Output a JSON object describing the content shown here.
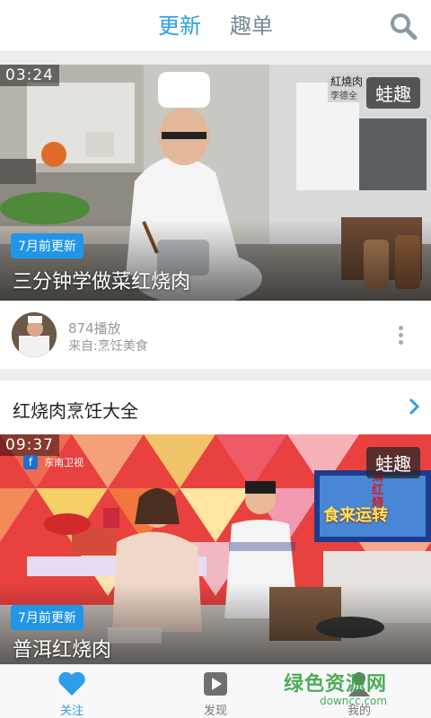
{
  "tabs": {
    "updates": "更新",
    "fun_lists": "趣单"
  },
  "colors": {
    "accent": "#2f9ee8",
    "badge": "#2196e8"
  },
  "icons": {
    "search": "search-icon",
    "more": "more-vertical-icon",
    "chevron": "chevron-right-icon",
    "follow": "heart-icon",
    "discover": "play-icon",
    "mine": "user-icon"
  },
  "video1": {
    "duration": "03:24",
    "brand": "蛙趣",
    "badge": "7月前更新",
    "title": "三分钟学做菜红烧肉",
    "overlay_caption": "紅燒肉",
    "overlay_sub": "李德全",
    "plays": "874播放",
    "source": "来自:烹饪美食"
  },
  "section": {
    "title": "红烧肉烹饪大全"
  },
  "video2": {
    "duration": "09:37",
    "channel": "东南卫视",
    "brand": "蛙趣",
    "badge": "7月前更新",
    "title": "普洱红烧肉",
    "screen_text_main": "食来运转",
    "screen_text_side": "洱红烧肉"
  },
  "bottom_nav": {
    "follow": "关注",
    "discover": "发现",
    "mine": "我的"
  },
  "watermark": {
    "title": "绿色资源网",
    "url": "downcc.com"
  }
}
